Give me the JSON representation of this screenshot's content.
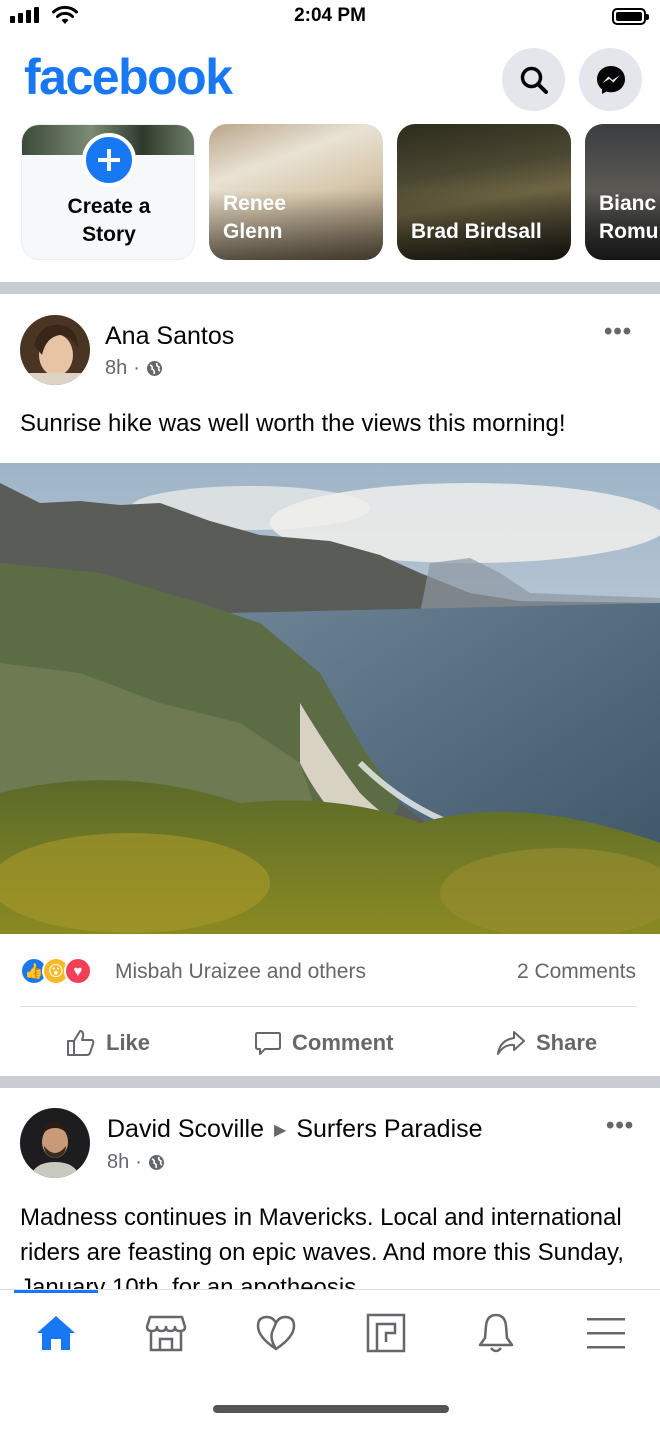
{
  "status_bar": {
    "time": "2:04 PM"
  },
  "header": {
    "logo": "facebook",
    "icons": [
      "search-icon",
      "messenger-icon"
    ]
  },
  "stories": [
    {
      "label": "Create a\nStory",
      "type": "create"
    },
    {
      "name": "Renee\nGlenn"
    },
    {
      "name": "Brad Birdsall"
    },
    {
      "name": "Bianc\nRomu"
    }
  ],
  "post1": {
    "author": "Ana Santos",
    "time": "8h",
    "privacy_icon": "globe-icon",
    "more": "•••",
    "text": "Sunrise hike was well worth the views this morning!",
    "reaction_icons": [
      "like-icon",
      "wow-icon",
      "love-icon"
    ],
    "reactions_text": "Misbah Uraizee and others",
    "comments": "2 Comments",
    "actions": {
      "like": "Like",
      "comment": "Comment",
      "share": "Share"
    }
  },
  "post2": {
    "author": "David Scoville",
    "group": "Surfers Paradise",
    "time": "8h",
    "privacy_icon": "globe-icon",
    "more": "•••",
    "text": "Madness continues in Mavericks. Local and international riders are feasting on epic waves. And more this Sunday, January 10th, for an apotheosis"
  },
  "bottom_nav": {
    "items": [
      "home-icon",
      "marketplace-icon",
      "dating-icon",
      "pages-icon",
      "notifications-icon",
      "menu-icon"
    ],
    "active": "home-icon",
    "accent": "#1877f2"
  }
}
